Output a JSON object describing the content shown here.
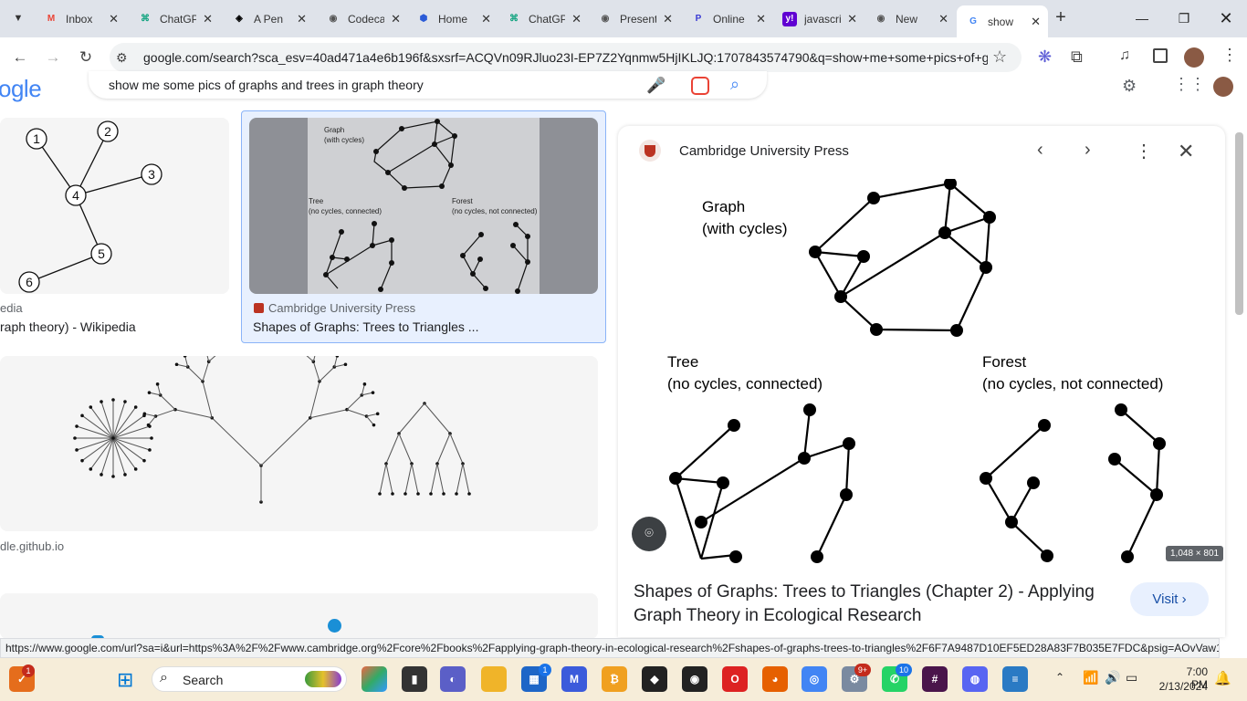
{
  "tabs": [
    {
      "title": "Inbox",
      "icon": "gmail-icon",
      "glyph": "M",
      "color": "#ea4335",
      "bg": "transparent"
    },
    {
      "title": "ChatGPT",
      "icon": "chatgpt-icon",
      "glyph": "⌘",
      "color": "#10a37f",
      "bg": "transparent"
    },
    {
      "title": "A Pen",
      "icon": "codepen-icon",
      "glyph": "◈",
      "color": "#000",
      "bg": "transparent"
    },
    {
      "title": "Codecademy",
      "icon": "globe-icon",
      "glyph": "◉",
      "color": "#555",
      "bg": "transparent"
    },
    {
      "title": "Home",
      "icon": "home-icon",
      "glyph": "⬢",
      "color": "#2b5bd7",
      "bg": "transparent"
    },
    {
      "title": "ChatGPT",
      "icon": "chatgpt-icon",
      "glyph": "⌘",
      "color": "#10a37f",
      "bg": "transparent"
    },
    {
      "title": "Presentation",
      "icon": "globe-icon",
      "glyph": "◉",
      "color": "#555",
      "bg": "transparent"
    },
    {
      "title": "Online",
      "icon": "p-icon",
      "glyph": "P",
      "color": "#3a3ad4",
      "bg": "transparent"
    },
    {
      "title": "javascript",
      "icon": "yahoo-icon",
      "glyph": "y!",
      "color": "#fff",
      "bg": "#6001d2"
    },
    {
      "title": "New",
      "icon": "globe-icon",
      "glyph": "◉",
      "color": "#555",
      "bg": "transparent"
    },
    {
      "title": "show",
      "icon": "google-icon",
      "glyph": "G",
      "color": "#4285f4",
      "bg": "transparent"
    }
  ],
  "address": {
    "url": "google.com/search?sca_esv=40ad471a4e6b196f&sxsrf=ACQVn09RJluo23I-EP7Z2Yqnmw5HjIKLJQ:1707843574790&q=show+me+some+pics+of+gr..."
  },
  "search": {
    "logo": "ogle",
    "query": "show me some pics of graphs and trees in graph theory"
  },
  "results": {
    "r1_source": "edia",
    "r1_title": "raph theory) - Wikipedia",
    "r2_source": "Cambridge University Press",
    "r2_title": "Shapes of Graphs: Trees to Triangles ...",
    "r3_source": "dle.github.io",
    "mini_graph": {
      "title": "Graph\n(with cycles)",
      "tree": "Tree\n(no cycles, connected)",
      "forest": "Forest\n(no cycles, not connected)"
    },
    "node_labels": [
      "1",
      "2",
      "3",
      "4",
      "5",
      "6"
    ]
  },
  "panel": {
    "source": "Cambridge University Press",
    "graph_label_1": "Graph",
    "graph_label_2": "(with cycles)",
    "tree_label_1": "Tree",
    "tree_label_2": "(no cycles, connected)",
    "forest_label_1": "Forest",
    "forest_label_2": "(no cycles, not connected)",
    "dimensions": "1,048 × 801",
    "title": "Shapes of Graphs: Trees to Triangles (Chapter 2) - Applying Graph Theory in Ecological Research",
    "visit": "Visit"
  },
  "status": "https://www.google.com/url?sa=i&url=https%3A%2F%2Fwww.cambridge.org%2Fcore%2Fbooks%2Fapplying-graph-theory-in-ecological-research%2Fshapes-of-graphs-trees-to-triangles%2F6F7A9487D10EF5ED28A83F7B035E7FDC&psig=AOvVaw1...",
  "taskbar": {
    "search": "Search",
    "time": "7:00 PM",
    "date": "2/13/2024",
    "badges": [
      "1",
      "1",
      "9+",
      "10"
    ]
  }
}
